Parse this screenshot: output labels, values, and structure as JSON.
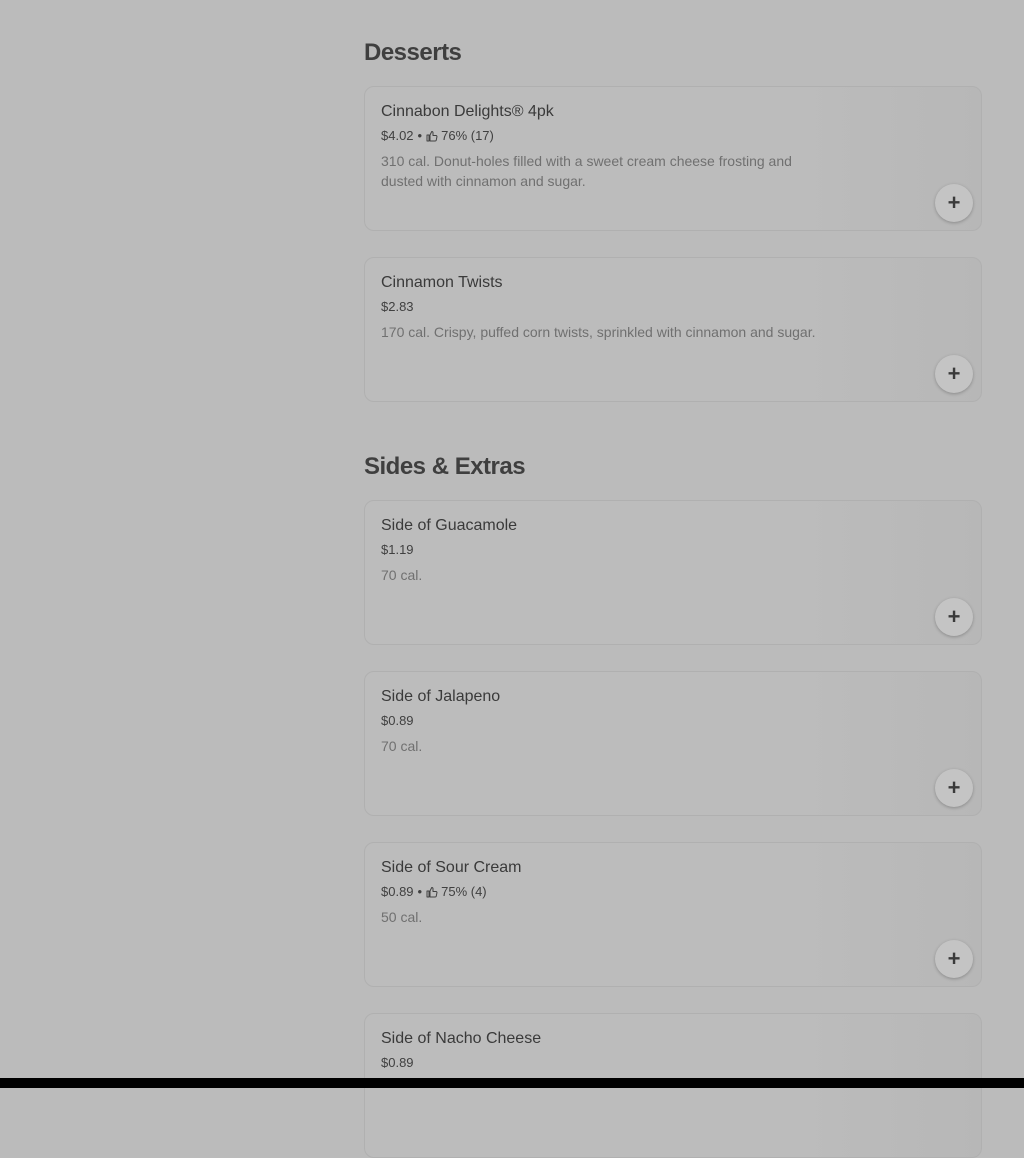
{
  "sections": [
    {
      "title": "Desserts",
      "items": [
        {
          "name": "Cinnabon Delights® 4pk",
          "price": "$4.02",
          "rating": "76% (17)",
          "description": "310 cal. Donut-holes filled with a sweet cream cheese frosting and dusted with cinnamon and sugar."
        },
        {
          "name": "Cinnamon Twists",
          "price": "$2.83",
          "rating": null,
          "description": "170 cal. Crispy, puffed corn twists, sprinkled with cinnamon and sugar."
        }
      ]
    },
    {
      "title": "Sides & Extras",
      "items": [
        {
          "name": "Side of Guacamole",
          "price": "$1.19",
          "rating": null,
          "description": "70 cal."
        },
        {
          "name": "Side of Jalapeno",
          "price": "$0.89",
          "rating": null,
          "description": "70 cal."
        },
        {
          "name": "Side of Sour Cream",
          "price": "$0.89",
          "rating": "75% (4)",
          "description": "50 cal."
        },
        {
          "name": "Side of Nacho Cheese",
          "price": "$0.89",
          "rating": null,
          "description": ""
        }
      ]
    }
  ],
  "add_label": "+",
  "separator": "•",
  "icons": {
    "rating": "thumbs-up-icon",
    "add": "plus-icon"
  }
}
